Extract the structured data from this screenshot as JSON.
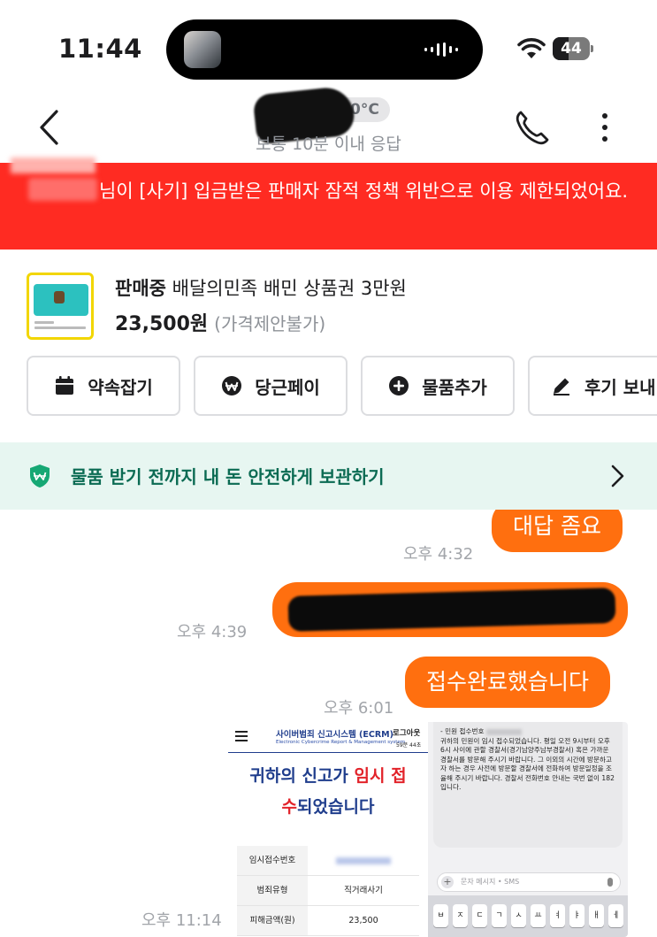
{
  "status_bar": {
    "time": "11:44",
    "battery": "44",
    "battery_level": 0.44
  },
  "header": {
    "temperature": "0°C",
    "response_time": "보통 10분 이내 응답",
    "back_icon": "chevron-left-icon",
    "call_icon": "phone-icon",
    "more_icon": "more-vertical-icon"
  },
  "notice": {
    "text": "님이 [사기] 입금받은 판매자 잠적 정책 위반으로 이용 제한되었어요."
  },
  "product": {
    "status": "판매중",
    "title": "배달의민족 배민 상품권 3만원",
    "price": "23,500원",
    "price_note": "(가격제안불가)"
  },
  "actions": [
    {
      "label": "약속잡기",
      "icon": "calendar-icon"
    },
    {
      "label": "당근페이",
      "icon": "won-pay-icon"
    },
    {
      "label": "물품추가",
      "icon": "plus-circle-icon"
    },
    {
      "label": "후기 보내",
      "icon": "pencil-icon"
    }
  ],
  "safepay": {
    "text": "물품 받기 전까지 내 돈 안전하게 보관하기"
  },
  "messages": [
    {
      "text": "대답 좀요",
      "time": "오후 4:32"
    },
    {
      "text": "",
      "time": "오후 4:39"
    },
    {
      "text": "접수완료했습니다",
      "time": "오후 6:01"
    },
    {
      "text": "",
      "time": "오후 11:14"
    }
  ],
  "screenshot": {
    "ecrm_title": "사이버범죄 신고시스템 (ECRM)",
    "ecrm_subtitle": "Electronic Cybercrime Report & Management system",
    "logout": "로그아웃",
    "timer": "59분 44초",
    "headline_a": "귀하의 신고가 ",
    "headline_red_a": "임시 접",
    "headline_red_b": "수",
    "headline_b": "되었습니다",
    "table": [
      {
        "key": "임시접수번호",
        "value": ""
      },
      {
        "key": "범죄유형",
        "value": "직거래사기"
      },
      {
        "key": "피해금액(원)",
        "value": "23,500"
      }
    ],
    "sms_line1": "- 민원 접수번호",
    "sms_body": "귀하의 민원이 임시 접수되었습니다. 평일 오전 9시부터 오후 6시 사이에 관할 경찰서(경기남양주남부경찰서) 혹은 가까운 경찰서를 방문해 주시기 바랍니다. 그 이외의 시간에 방문하고자 하는 경우 사전에 방문할 경찰서에 전화하여 방문일정을 조율해 주시기 바랍니다. 경찰서 전화번호 안내는 국번 없이 182입니다.",
    "sms_placeholder": "문자 메시지 • SMS",
    "keys": [
      "ㅂ",
      "ㅈ",
      "ㄷ",
      "ㄱ",
      "ㅅ",
      "ㅛ",
      "ㅕ",
      "ㅑ",
      "ㅐ",
      "ㅔ"
    ]
  },
  "colors": {
    "accent_orange": "#ff6f0f",
    "notice_red": "#ff2b22",
    "safepay_green": "#0b6b53"
  }
}
